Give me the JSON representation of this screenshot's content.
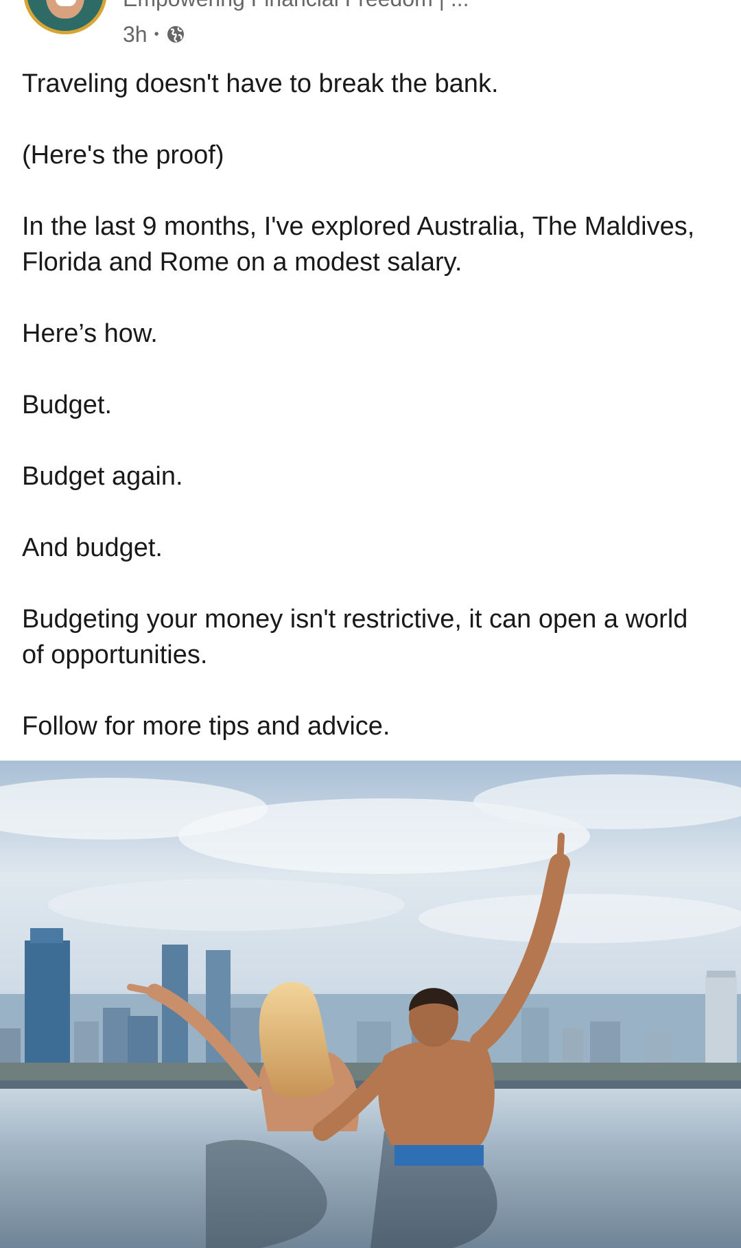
{
  "author": {
    "headline": "Empowering Financial Freedom | ...",
    "time": "3h",
    "separator": "•",
    "visibility_icon": "globe-icon"
  },
  "post": {
    "paragraphs": [
      "Traveling doesn't have to break the bank.",
      "(Here's the proof)",
      "In the last 9 months, I've explored Australia, The Maldives, Florida and Rome on a modest salary.",
      "Here’s how.",
      "Budget.",
      "Budget again.",
      "And budget.",
      "Budgeting your money isn't restrictive, it can open a world of opportunities.",
      "Follow for more tips and advice."
    ]
  },
  "image": {
    "subject": "couple-in-infinity-pool-over-city-skyline"
  },
  "colors": {
    "text": "#191919",
    "meta": "#666666",
    "avatar_ring": "#d7a534"
  }
}
